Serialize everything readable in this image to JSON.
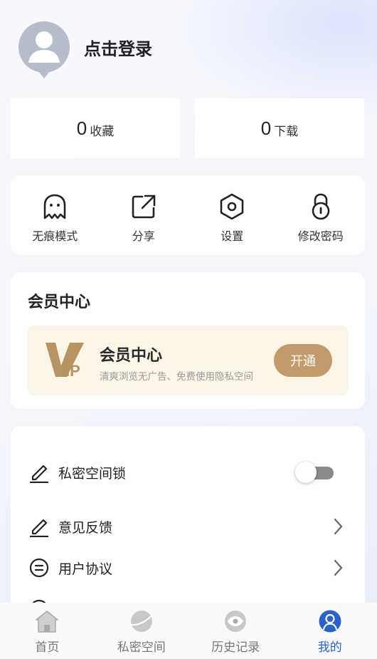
{
  "profile": {
    "login_text": "点击登录",
    "avatar_icon": "person-icon"
  },
  "stats": [
    {
      "count": "0",
      "label": "收藏"
    },
    {
      "count": "0",
      "label": "下载"
    }
  ],
  "quick_actions": [
    {
      "label": "无痕模式",
      "icon": "ghost-icon"
    },
    {
      "label": "分享",
      "icon": "share-icon"
    },
    {
      "label": "设置",
      "icon": "settings-hexagon-icon"
    },
    {
      "label": "修改密码",
      "icon": "lock-icon"
    }
  ],
  "membership": {
    "section_title": "会员中心",
    "banner_title": "会员中心",
    "banner_desc": "清爽浏览无广告、免费使用隐私空间",
    "button_label": "开通",
    "logo_text": "VIP",
    "accent_color": "#c39a6b"
  },
  "settings": {
    "items": [
      {
        "label": "私密空间锁",
        "icon": "pen-icon",
        "control": "toggle",
        "toggle_on": false
      },
      {
        "label": "意见反馈",
        "icon": "pen-icon",
        "control": "chevron"
      },
      {
        "label": "用户协议",
        "icon": "list-circle-icon",
        "control": "chevron"
      }
    ]
  },
  "bottom_nav": {
    "items": [
      {
        "label": "首页",
        "icon": "home-icon",
        "active": false
      },
      {
        "label": "私密空间",
        "icon": "planet-icon",
        "active": false
      },
      {
        "label": "历史记录",
        "icon": "eye-icon",
        "active": false
      },
      {
        "label": "我的",
        "icon": "user-icon",
        "active": true
      }
    ],
    "active_color": "#2b63c8"
  }
}
